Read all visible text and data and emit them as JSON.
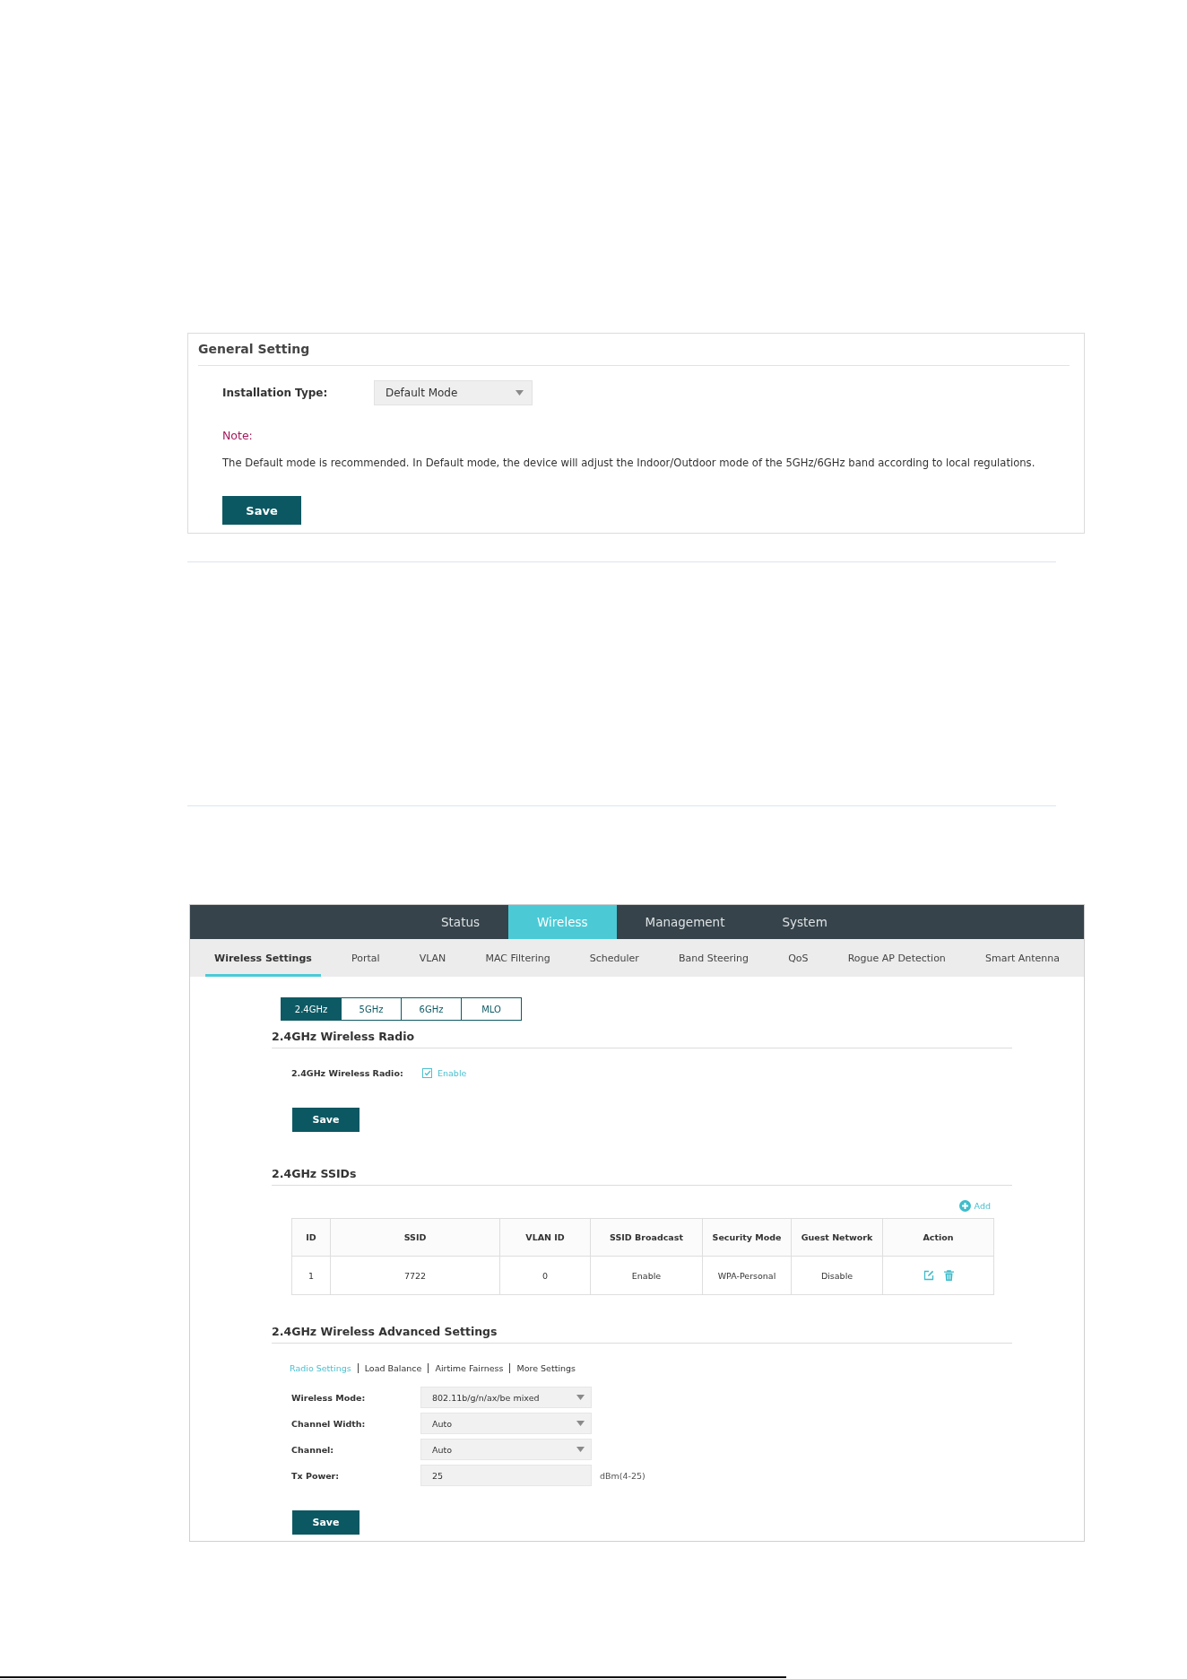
{
  "general_setting": {
    "title": "General Setting",
    "installation_type": {
      "label": "Installation Type:",
      "value": "Default Mode"
    },
    "note": {
      "label": "Note:",
      "text": "The Default mode is recommended. In Default mode, the device will adjust the Indoor/Outdoor mode of the 5GHz/6GHz band according to local regulations."
    },
    "save_button": "Save"
  },
  "web_ui": {
    "top_nav": [
      {
        "label": "Status",
        "selected": false
      },
      {
        "label": "Wireless",
        "selected": true
      },
      {
        "label": "Management",
        "selected": false
      },
      {
        "label": "System",
        "selected": false
      }
    ],
    "sub_nav": [
      {
        "label": "Wireless Settings",
        "selected": true
      },
      {
        "label": "Portal",
        "selected": false
      },
      {
        "label": "VLAN",
        "selected": false
      },
      {
        "label": "MAC Filtering",
        "selected": false
      },
      {
        "label": "Scheduler",
        "selected": false
      },
      {
        "label": "Band Steering",
        "selected": false
      },
      {
        "label": "QoS",
        "selected": false
      },
      {
        "label": "Rogue AP Detection",
        "selected": false
      },
      {
        "label": "Smart Antenna",
        "selected": false
      }
    ],
    "band_tabs": [
      {
        "label": "2.4GHz",
        "selected": true
      },
      {
        "label": "5GHz",
        "selected": false
      },
      {
        "label": "6GHz",
        "selected": false
      },
      {
        "label": "MLO",
        "selected": false
      }
    ],
    "radio_section": {
      "title": "2.4GHz Wireless Radio",
      "label": "2.4GHz Wireless Radio:",
      "checkbox": {
        "label": "Enable",
        "checked": true
      },
      "save_button": "Save"
    },
    "ssid_section": {
      "title": "2.4GHz SSIDs",
      "add_button": "Add",
      "table": {
        "columns": [
          "ID",
          "SSID",
          "VLAN ID",
          "SSID Broadcast",
          "Security Mode",
          "Guest Network",
          "Action"
        ],
        "rows": [
          {
            "cells": [
              "1",
              "7722",
              "0",
              "Enable",
              "WPA-Personal",
              "Disable"
            ]
          }
        ]
      }
    },
    "advanced_section": {
      "title": "2.4GHz Wireless Advanced Settings",
      "links": [
        {
          "label": "Radio Settings",
          "selected": true
        },
        {
          "label": "Load Balance",
          "selected": false
        },
        {
          "label": "Airtime Fairness",
          "selected": false
        },
        {
          "label": "More Settings",
          "selected": false
        }
      ],
      "fields": [
        {
          "kind": "select",
          "label": "Wireless Mode:",
          "value": "802.11b/g/n/ax/be mixed"
        },
        {
          "kind": "select",
          "label": "Channel Width:",
          "value": "Auto"
        },
        {
          "kind": "select",
          "label": "Channel:",
          "value": "Auto"
        },
        {
          "kind": "text",
          "label": "Tx Power:",
          "value": "25",
          "unit": "dBm(4-25)"
        }
      ],
      "save_button": "Save"
    }
  }
}
